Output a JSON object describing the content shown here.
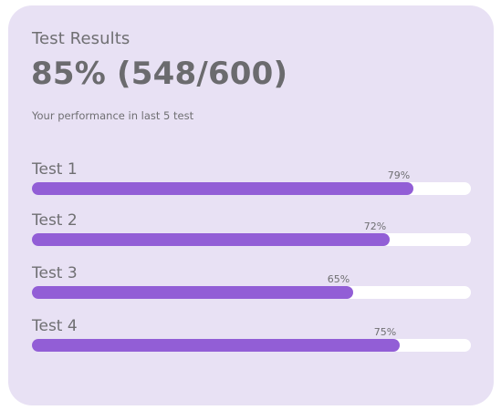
{
  "card": {
    "title": "Test Results",
    "score": "85% (548/600)",
    "subtitle": "Your performance in last 5 test"
  },
  "tests": [
    {
      "label": "Test 1",
      "percent_text": "79%",
      "fill_fraction": 0.87
    },
    {
      "label": "Test 2",
      "percent_text": "72%",
      "fill_fraction": 0.815
    },
    {
      "label": "Test 3",
      "percent_text": "65%",
      "fill_fraction": 0.732
    },
    {
      "label": "Test 4",
      "percent_text": "75%",
      "fill_fraction": 0.838
    }
  ],
  "colors": {
    "card_background": "#e8e1f4",
    "bar_fill": "#925ed6",
    "bar_track": "#ffffff",
    "text": "#6f6f72"
  }
}
